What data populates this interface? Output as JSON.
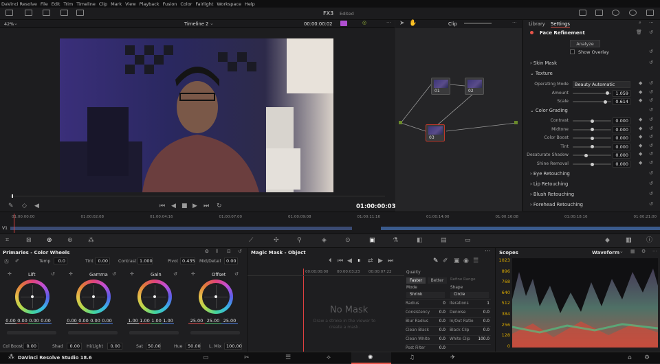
{
  "menu": [
    "DaVinci Resolve",
    "File",
    "Edit",
    "Trim",
    "Timeline",
    "Clip",
    "Mark",
    "View",
    "Playback",
    "Fusion",
    "Color",
    "Fairlight",
    "Workspace",
    "Help"
  ],
  "project": {
    "name": "FX3",
    "status": "Edited"
  },
  "viewer": {
    "zoom": "42%",
    "timeline": "Timeline 2",
    "timecode": "00:00:00:02",
    "current_time": "01:00:00:03",
    "playhead": 0.05
  },
  "nodes": {
    "mode": "Clip",
    "items": [
      {
        "label": "01"
      },
      {
        "label": "02"
      },
      {
        "label": "03"
      }
    ]
  },
  "inspector": {
    "tabs": [
      "Library",
      "Settings"
    ],
    "title": "Face Refinement",
    "analyze": "Analyze",
    "show_overlay": "Show Overlay",
    "sections": {
      "skin_mask": "Skin Mask",
      "texture": "Texture",
      "color_grading": "Color Grading",
      "eye": "Eye Retouching",
      "lip": "Lip Retouching",
      "blush": "Blush Retouching",
      "forehead": "Forehead Retouching"
    },
    "texture_rows": [
      {
        "label": "Operating Mode",
        "value": "Beauty Automatic"
      },
      {
        "label": "Amount",
        "value": "1.059",
        "level": 0.9
      },
      {
        "label": "Scale",
        "value": "0.614",
        "level": 0.85
      }
    ],
    "grading_rows": [
      {
        "label": "Contrast",
        "value": "0.000",
        "level": 0.5
      },
      {
        "label": "Midtone",
        "value": "0.000",
        "level": 0.5
      },
      {
        "label": "Color Boost",
        "value": "0.000",
        "level": 0.5
      },
      {
        "label": "Tint",
        "value": "0.000",
        "level": 0.5
      },
      {
        "label": "Desaturate Shadow",
        "value": "0.000",
        "level": 0.35
      },
      {
        "label": "Shine Removal",
        "value": "0.000",
        "level": 0.5
      }
    ]
  },
  "timeline_ticks": [
    "01:00:00:00",
    "01:00:02:08",
    "01:00:04:16",
    "01:00:07:00",
    "01:00:09:08",
    "01:00:11:16",
    "01:00:14:00",
    "01:00:16:08",
    "01:00:18:16",
    "01:00:21:00"
  ],
  "track": "V1",
  "primaries": {
    "title": "Primaries - Color Wheels",
    "temp_label": "Temp",
    "temp": "0.0",
    "tint_label": "Tint",
    "tint": "0.00",
    "contrast_label": "Contrast",
    "contrast": "1.000",
    "pivot_label": "Pivot",
    "pivot": "0.435",
    "mid_label": "Mid/Detail",
    "mid": "0.00",
    "wheels": [
      {
        "name": "Lift",
        "vals": [
          "0.00",
          "0.00",
          "0.00",
          "0.00"
        ]
      },
      {
        "name": "Gamma",
        "vals": [
          "0.00",
          "0.00",
          "0.00",
          "0.00"
        ]
      },
      {
        "name": "Gain",
        "vals": [
          "1.00",
          "1.00",
          "1.00",
          "1.00"
        ]
      },
      {
        "name": "Offset",
        "vals": [
          "25.00",
          "25.00",
          "25.00"
        ]
      }
    ],
    "bottom": [
      {
        "label": "Col Boost",
        "value": "0.00"
      },
      {
        "label": "Shad",
        "value": "0.00"
      },
      {
        "label": "Hi/Light",
        "value": "0.00"
      },
      {
        "label": "Sat",
        "value": "50.00"
      },
      {
        "label": "Hue",
        "value": "50.00"
      },
      {
        "label": "L. Mix",
        "value": "100.00"
      }
    ]
  },
  "mask": {
    "title": "Magic Mask - Object",
    "tc1": "00:00:00:00",
    "tc2": "00:00:03:23",
    "tc3": "00:00:07:22",
    "no_mask": "No Mask",
    "hint": "Draw a stroke in the viewer to create a mask.",
    "quality": "Quality",
    "faster": "Faster",
    "better": "Better",
    "refine": "Refine Range",
    "mode": "Mode",
    "shape": "Shape",
    "shrink": "Shrink",
    "circle": "Circle",
    "rows": [
      [
        "Radius",
        "0",
        "Iterations",
        "1"
      ],
      [
        "Consistency",
        "0.0",
        "Denoise",
        "0.0"
      ],
      [
        "Blur Radius",
        "0.0",
        "In/Out Ratio",
        "0.0"
      ],
      [
        "Clean Black",
        "0.0",
        "Black Clip",
        "0.0"
      ],
      [
        "Clean White",
        "0.0",
        "White Clip",
        "100.0"
      ],
      [
        "Post Filter",
        "0.0",
        "",
        ""
      ]
    ]
  },
  "scopes": {
    "title": "Scopes",
    "mode": "Waveform",
    "scale": [
      "1023",
      "896",
      "768",
      "640",
      "512",
      "384",
      "256",
      "128",
      "0"
    ]
  },
  "app": {
    "name": "DaVinci Resolve Studio 18.6"
  },
  "colors": {
    "accent": "#e8554a",
    "playhead": "#e04040"
  }
}
